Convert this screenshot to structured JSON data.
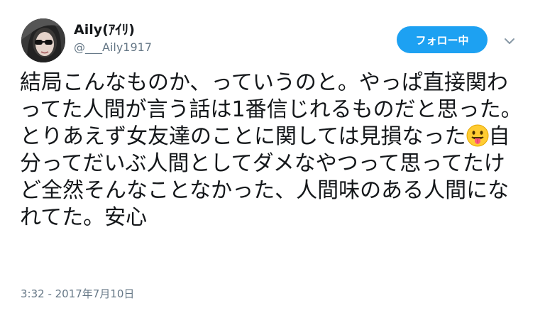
{
  "user": {
    "display_name": "Aily(ｱｲﾘ)",
    "handle": "@___Aily1917",
    "avatar": "avatar"
  },
  "follow_button": {
    "label": "フォロー中",
    "color": "#1da1f2"
  },
  "more_menu_icon": "chevron-down-icon",
  "tweet": {
    "text_before_emoji": "結局こんなものか、っていうのと。やっぱ直接関わってた人間が言う話は1番信じれるものだと思った。とりあえず女友達のことに関しては見損なった",
    "emoji": "face-with-tongue-emoji",
    "text_after_emoji": "自分ってだいぶ人間としてダメなやつって思ってたけど全然そんなことなかった、人間味のある人間になれてた。安心",
    "timestamp": "3:32 - 2017年7月10日"
  }
}
